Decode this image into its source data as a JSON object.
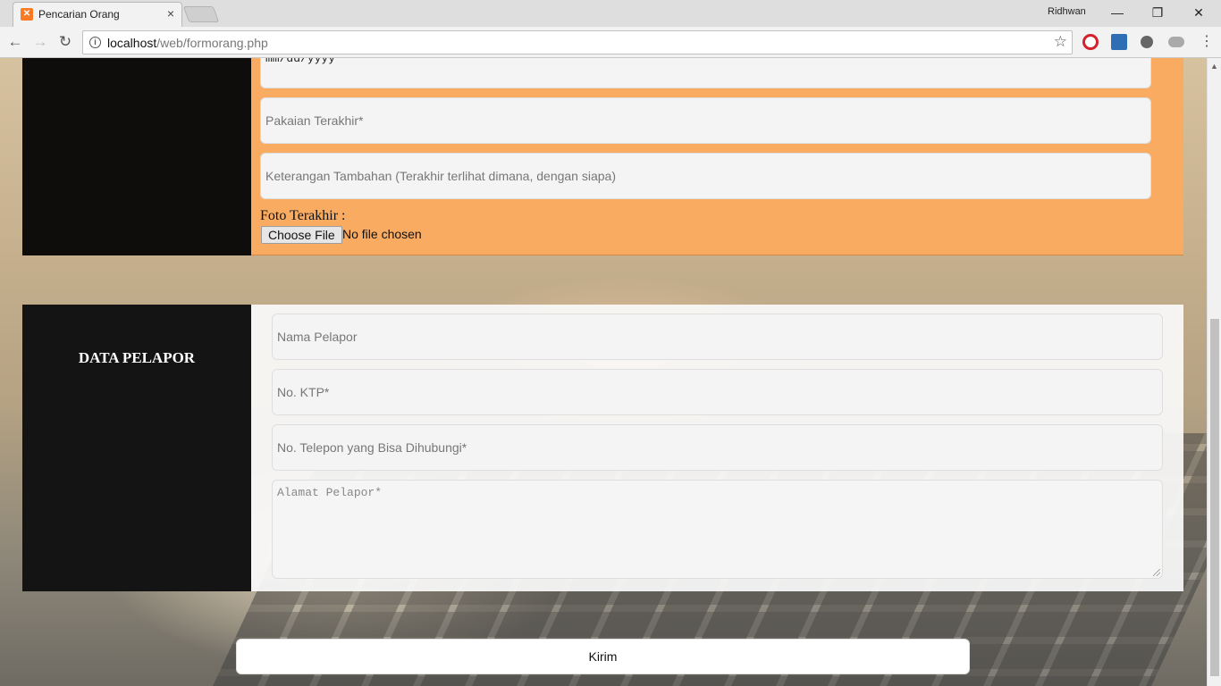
{
  "browser": {
    "tab_title": "Pencarian Orang",
    "tab_close": "×",
    "profile_name": "Ridhwan",
    "url_host": "localhost",
    "url_path": "/web/formorang.php",
    "window_controls": {
      "minimize": "—",
      "restore": "❐",
      "close": "✕"
    },
    "nav": {
      "back": "←",
      "forward": "→",
      "reload": "↻",
      "star": "☆",
      "menu": "⋮"
    }
  },
  "section_orang": {
    "date_placeholder": "mm/dd/yyyy",
    "pakaian_placeholder": "Pakaian Terakhir*",
    "keterangan_placeholder": "Keterangan Tambahan (Terakhir terlihat dimana, dengan siapa)",
    "foto_label": "Foto Terakhir :",
    "file_button": "Choose File",
    "file_status": "No file chosen"
  },
  "section_pelapor": {
    "title": "DATA PELAPOR",
    "nama_placeholder": "Nama Pelapor",
    "ktp_placeholder": "No. KTP*",
    "telepon_placeholder": "No. Telepon yang Bisa Dihubungi*",
    "alamat_placeholder": "Alamat Pelapor*"
  },
  "submit_label": "Kirim",
  "colors": {
    "orange_panel": "#f9ab62",
    "dark_panel": "#141414",
    "xampp_orange": "#fb7a24"
  }
}
